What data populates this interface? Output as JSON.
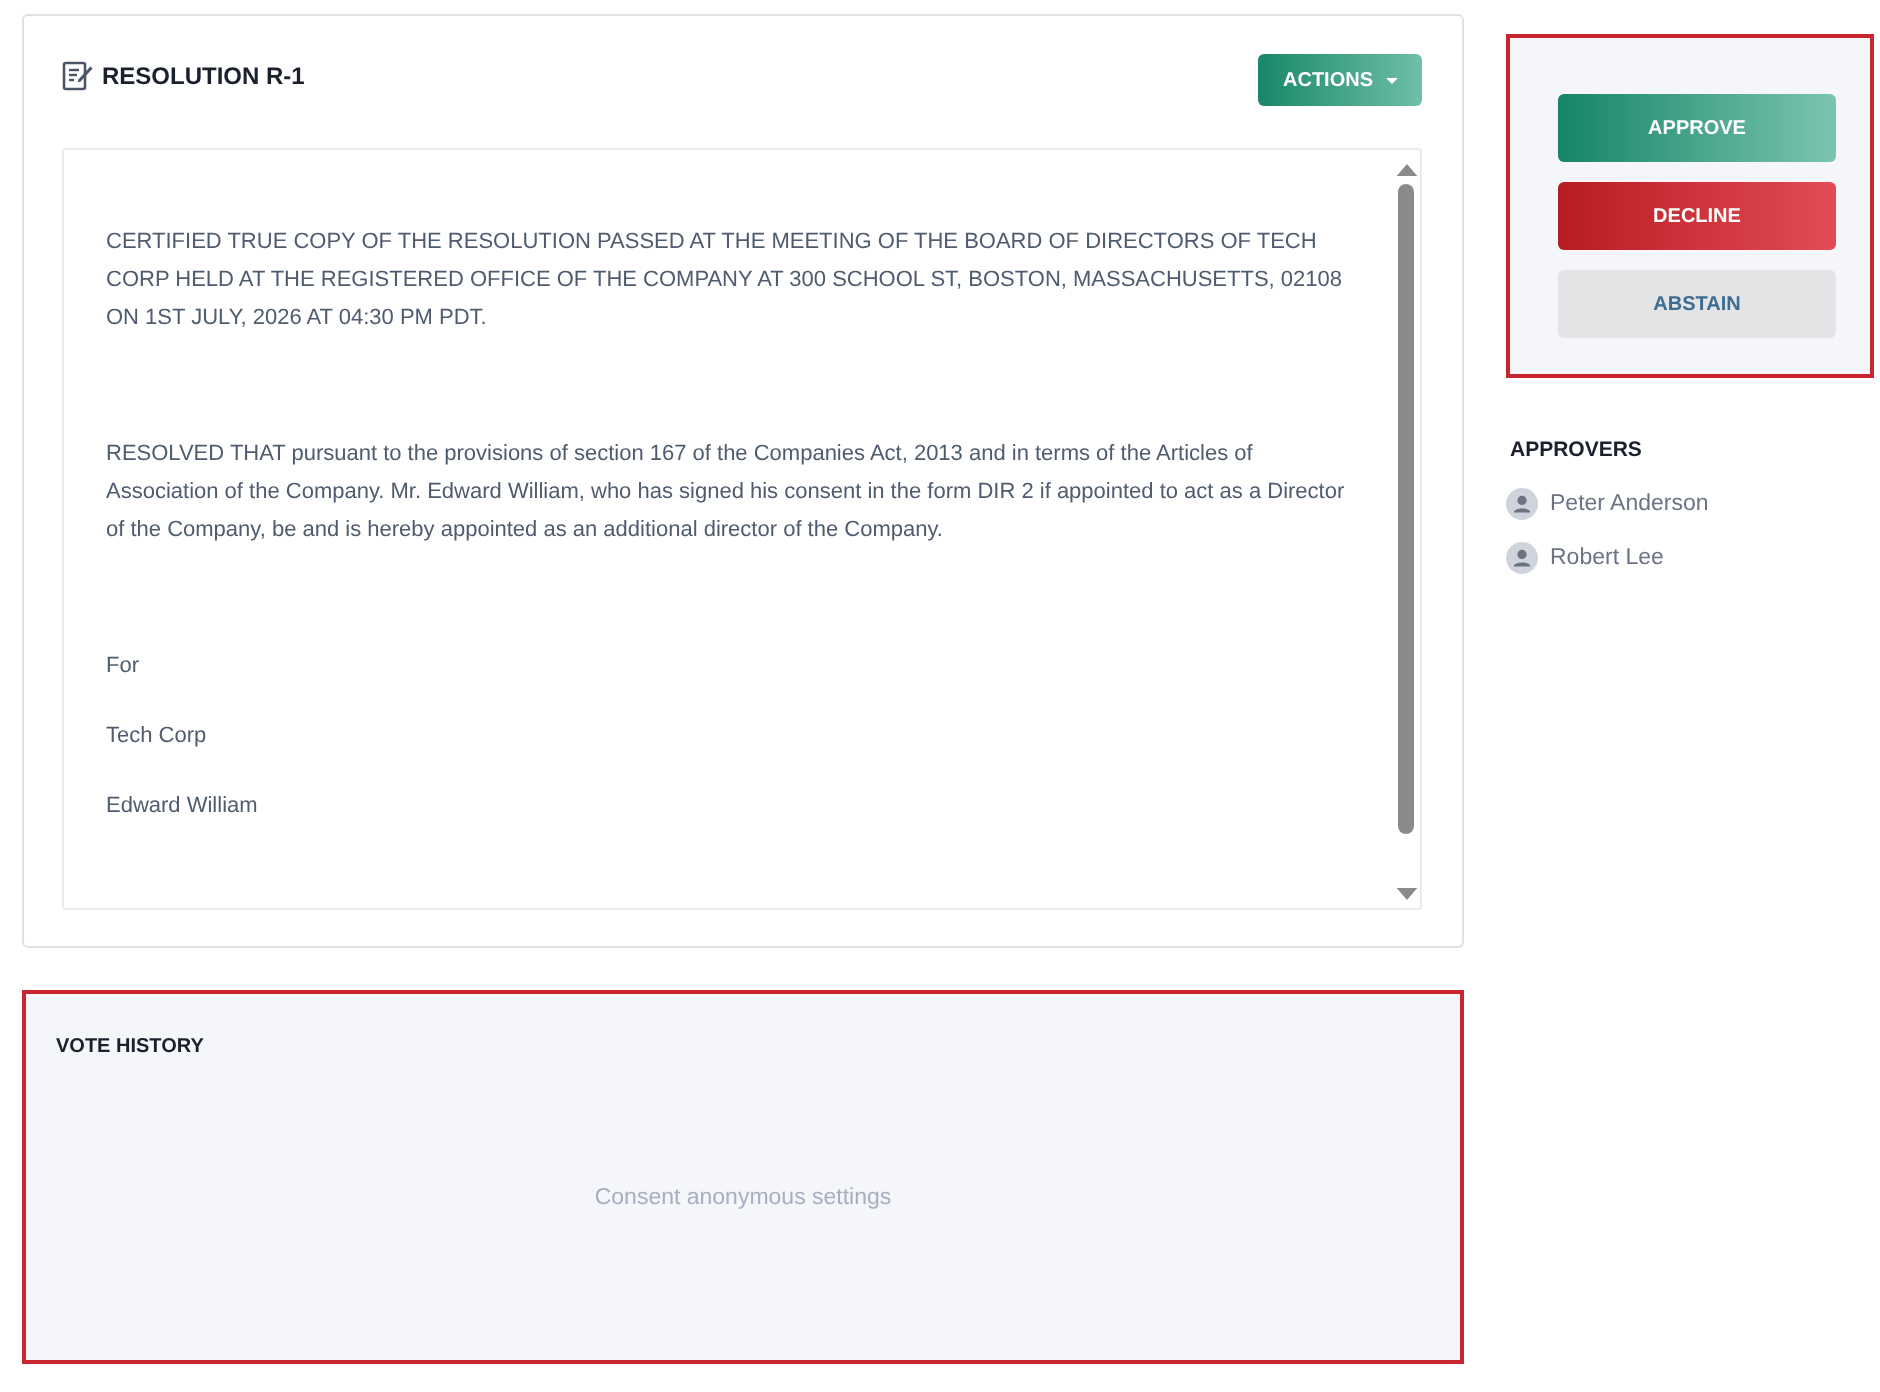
{
  "resolution": {
    "title": "RESOLUTION R-1",
    "actions_button": "ACTIONS",
    "document": {
      "paragraphs": [
        "CERTIFIED TRUE COPY OF THE RESOLUTION PASSED AT THE MEETING OF THE BOARD OF DIRECTORS OF TECH CORP HELD AT THE REGISTERED OFFICE OF THE COMPANY AT 300 SCHOOL ST, BOSTON, MASSACHUSETTS, 02108 ON 1ST JULY, 2026 AT 04:30 PM PDT.",
        "RESOLVED THAT pursuant to the provisions of section 167 of the Companies Act, 2013 and in terms of the Articles of Association of the Company. Mr. Edward William, who has signed his consent in the form DIR 2 if appointed to act as a Director of the Company, be and is hereby appointed as an additional director of the Company."
      ],
      "signature": [
        "For",
        "Tech Corp",
        "Edward William"
      ]
    }
  },
  "vote_panel": {
    "buttons": [
      {
        "label": "APPROVE",
        "kind": "approve"
      },
      {
        "label": "DECLINE",
        "kind": "decline"
      },
      {
        "label": "ABSTAIN",
        "kind": "abstain"
      }
    ]
  },
  "approvers": {
    "title": "APPROVERS",
    "people": [
      "Peter Anderson",
      "Robert Lee"
    ]
  },
  "vote_history": {
    "title": "VOTE HISTORY",
    "empty_message": "Consent anonymous settings"
  }
}
